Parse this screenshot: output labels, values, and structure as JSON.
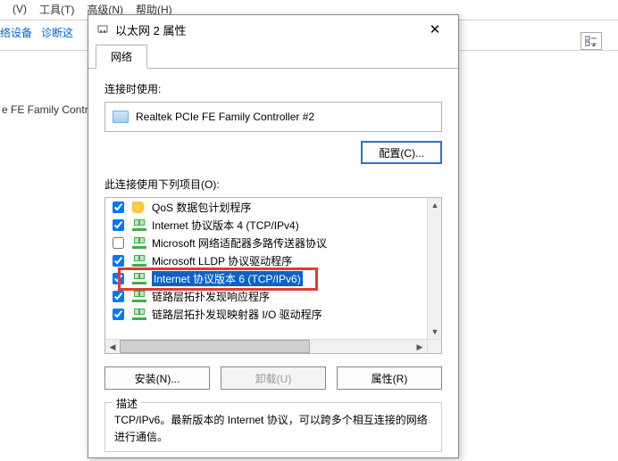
{
  "bg": {
    "menu_items": [
      "(V)",
      "工具(T)",
      "高级(N)",
      "帮助(H)"
    ],
    "toolbar_items": [
      "络设备",
      "诊断这"
    ],
    "partial_row": "e FE Family Contr"
  },
  "dialog": {
    "title": "以太网 2 属性",
    "close_glyph": "✕",
    "tab_network": "网络",
    "connect_using_label": "连接时使用:",
    "adapter_name": "Realtek PCIe FE Family Controller #2",
    "configure_button": "配置(C)...",
    "items_label": "此连接使用下列项目(O):",
    "install_button": "安装(N)...",
    "uninstall_button": "卸载(U)",
    "properties_button": "属性(R)",
    "desc_legend": "描述",
    "desc_text": "TCP/IPv6。最新版本的 Internet 协议，可以跨多个相互连接的网络进行通信。"
  },
  "list": {
    "items": [
      {
        "checked": true,
        "icon": "qos",
        "label": "QoS 数据包计划程序"
      },
      {
        "checked": true,
        "icon": "net",
        "label": "Internet 协议版本 4 (TCP/IPv4)"
      },
      {
        "checked": false,
        "icon": "net",
        "label": "Microsoft 网络适配器多路传送器协议"
      },
      {
        "checked": true,
        "icon": "net",
        "label": "Microsoft LLDP 协议驱动程序"
      },
      {
        "checked": true,
        "icon": "net",
        "label": "Internet 协议版本 6 (TCP/IPv6)",
        "selected": true
      },
      {
        "checked": true,
        "icon": "net",
        "label": "链路层拓扑发现响应程序"
      },
      {
        "checked": true,
        "icon": "net",
        "label": "链路层拓扑发现映射器 I/O 驱动程序"
      }
    ]
  }
}
